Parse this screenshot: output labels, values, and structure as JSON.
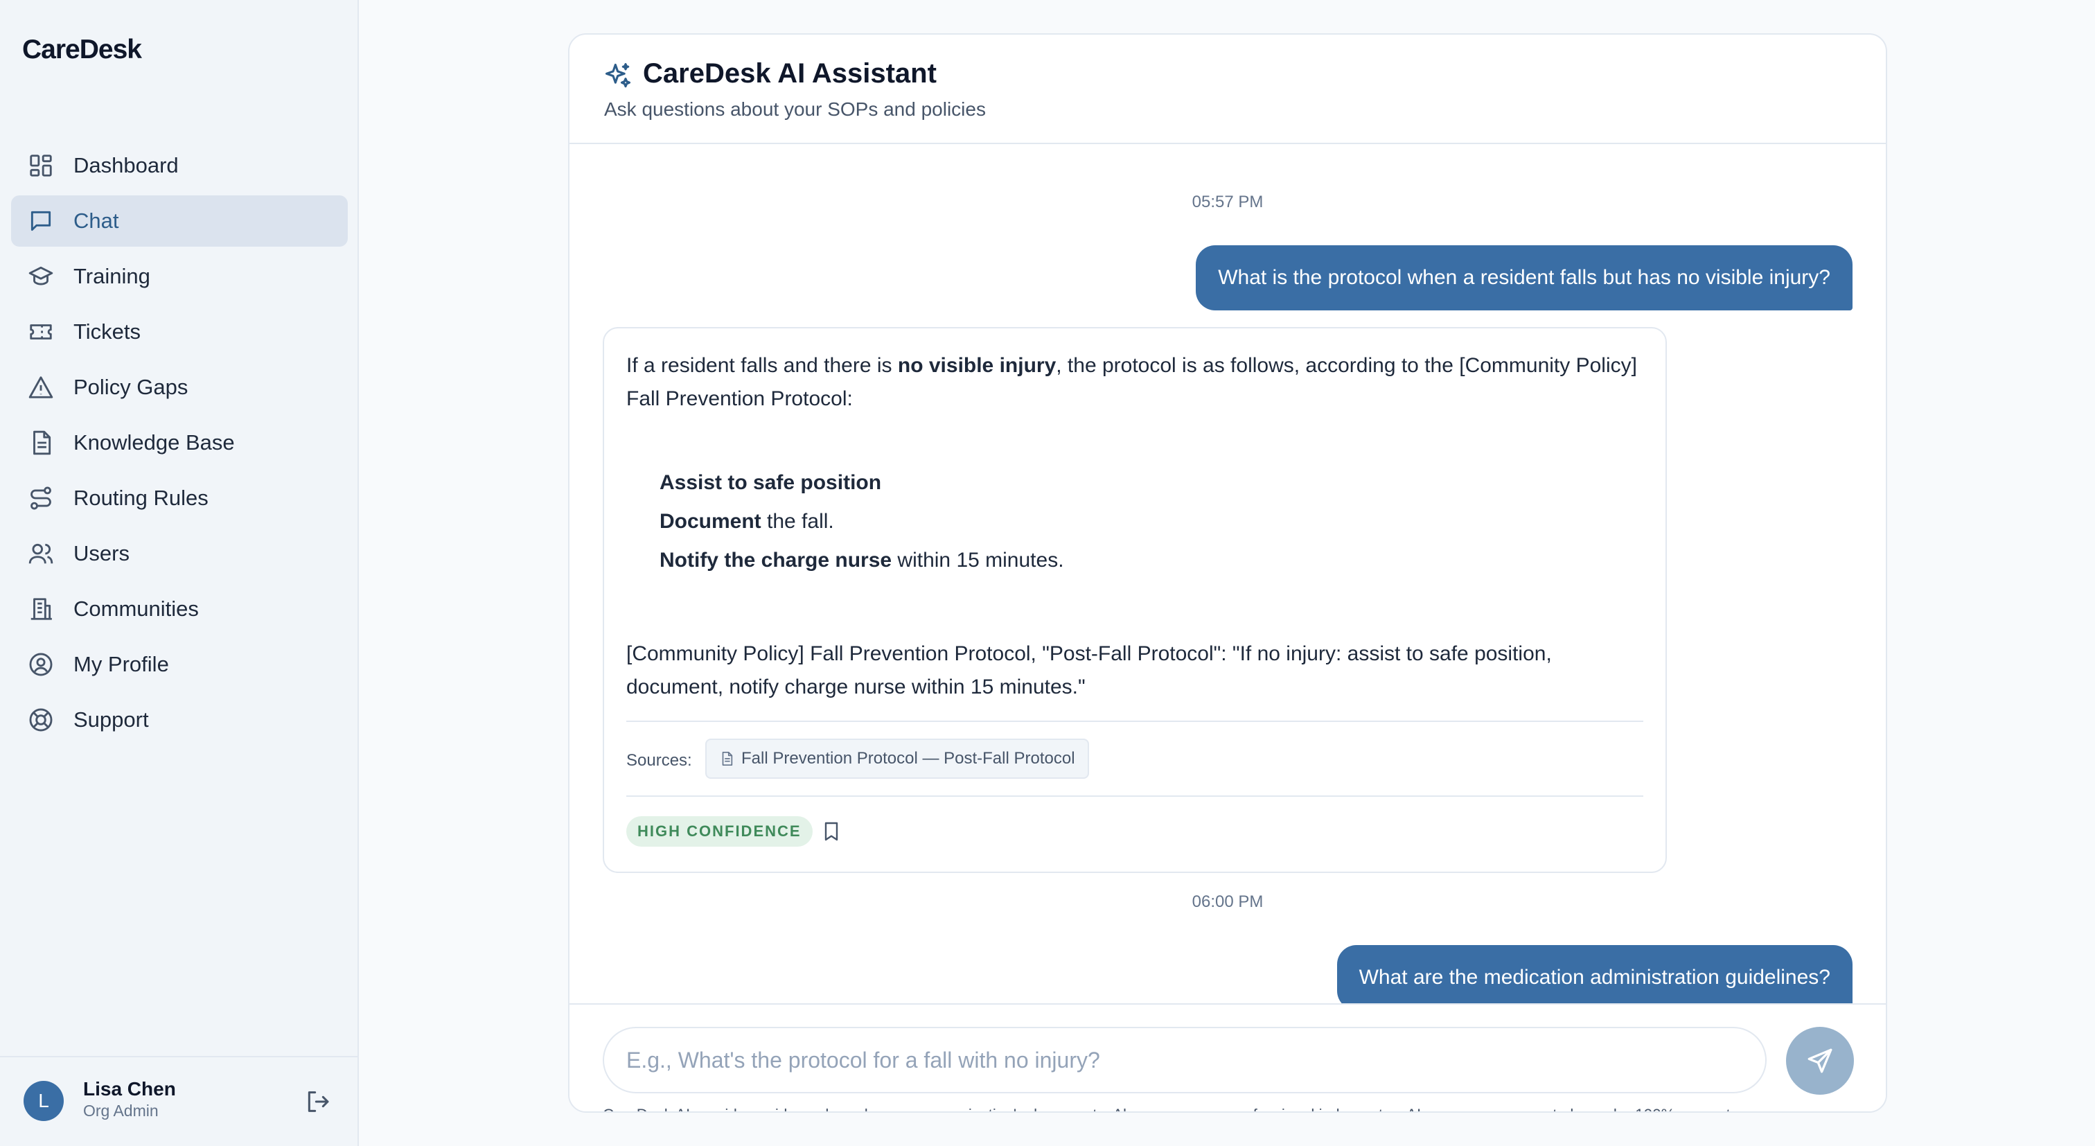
{
  "app": {
    "name": "CareDesk"
  },
  "sidebar": {
    "items": [
      {
        "label": "Dashboard",
        "icon": "dashboard-icon",
        "active": false
      },
      {
        "label": "Chat",
        "icon": "chat-icon",
        "active": true
      },
      {
        "label": "Training",
        "icon": "graduation-cap-icon",
        "active": false
      },
      {
        "label": "Tickets",
        "icon": "ticket-icon",
        "active": false
      },
      {
        "label": "Policy Gaps",
        "icon": "warning-triangle-icon",
        "active": false
      },
      {
        "label": "Knowledge Base",
        "icon": "document-icon",
        "active": false
      },
      {
        "label": "Routing Rules",
        "icon": "route-icon",
        "active": false
      },
      {
        "label": "Users",
        "icon": "users-icon",
        "active": false
      },
      {
        "label": "Communities",
        "icon": "building-icon",
        "active": false
      },
      {
        "label": "My Profile",
        "icon": "user-circle-icon",
        "active": false
      },
      {
        "label": "Support",
        "icon": "lifebuoy-icon",
        "active": false
      }
    ],
    "user": {
      "initial": "L",
      "name": "Lisa Chen",
      "role": "Org Admin"
    }
  },
  "chat": {
    "title": "CareDesk AI Assistant",
    "subtitle": "Ask questions about your SOPs and policies",
    "messages": [
      {
        "timestamp": "05:57 PM",
        "user": "What is the protocol when a resident falls but has no visible injury?",
        "ai": {
          "intro_1": "If a resident falls and there is ",
          "intro_bold": "no visible injury",
          "intro_2": ", the protocol is as follows, according to the [Community Policy] Fall Prevention Protocol:",
          "steps": [
            {
              "bold": "Assist to safe position",
              "rest": ""
            },
            {
              "bold": "Document",
              "rest": " the fall."
            },
            {
              "bold": "Notify the charge nurse",
              "rest": " within 15 minutes."
            }
          ],
          "citation": "[Community Policy] Fall Prevention Protocol, \"Post-Fall Protocol\": \"If no injury: assist to safe position, document, notify charge nurse within 15 minutes.\"",
          "sources_label": "Sources:",
          "source": "Fall Prevention Protocol — Post-Fall Protocol",
          "confidence": "HIGH CONFIDENCE"
        }
      },
      {
        "timestamp": "06:00 PM",
        "user": "What are the medication administration guidelines?"
      }
    ],
    "input": {
      "value": "",
      "placeholder": "E.g., What's the protocol for a fall with no injury?"
    },
    "disclaimer": "CareDesk AI provides guidance based on your organization's documents. Always use your professional judgment — AI responses may not always be 100% accurate."
  },
  "colors": {
    "accent": "#3a6ea5",
    "active_nav_bg": "#dbe3ee",
    "send_button": "#98b3cc",
    "confidence_bg": "#e3f2e8",
    "confidence_text": "#3f8a5a"
  }
}
